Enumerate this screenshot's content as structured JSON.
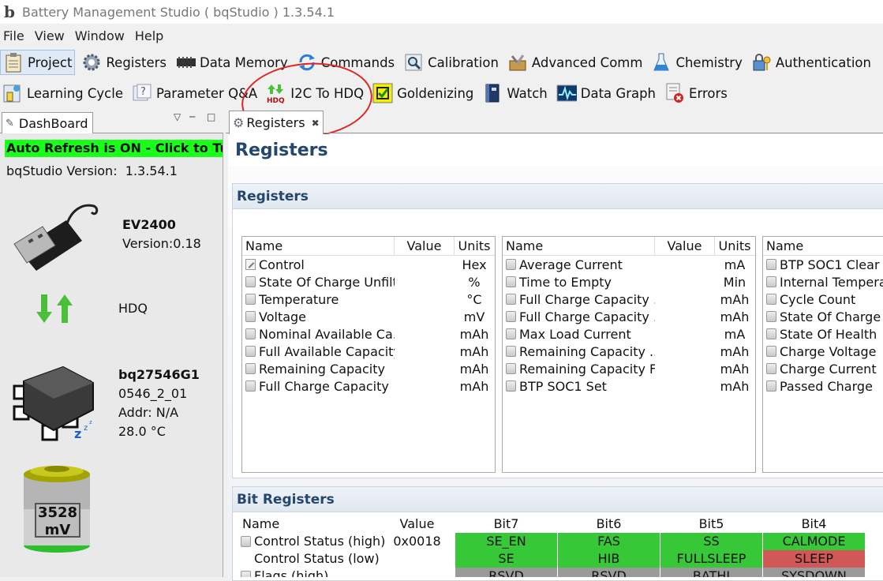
{
  "window": {
    "title": "Battery Management Studio ( bqStudio ) 1.3.54.1"
  },
  "menu": [
    "File",
    "View",
    "Window",
    "Help"
  ],
  "toolbar1": [
    {
      "label": "Project",
      "icon": "clipboard-icon"
    },
    {
      "label": "Registers",
      "icon": "gear-icon"
    },
    {
      "label": "Data Memory",
      "icon": "chip-icon"
    },
    {
      "label": "Commands",
      "icon": "refresh-arrows-icon"
    },
    {
      "label": "Calibration",
      "icon": "magnifier-icon"
    },
    {
      "label": "Advanced Comm",
      "icon": "tools-icon"
    },
    {
      "label": "Chemistry",
      "icon": "flask-icon"
    },
    {
      "label": "Authentication",
      "icon": "lock-key-icon"
    }
  ],
  "toolbar2": [
    {
      "label": "Learning Cycle",
      "icon": "learning-cycle-icon"
    },
    {
      "label": "Parameter Q&A",
      "icon": "question-icon"
    },
    {
      "label": "I2C To HDQ",
      "icon": "i2c-hdq-icon"
    },
    {
      "label": "Goldenizing",
      "icon": "checkbox-icon"
    },
    {
      "label": "Watch",
      "icon": "book-icon"
    },
    {
      "label": "Data Graph",
      "icon": "graph-icon"
    },
    {
      "label": "Errors",
      "icon": "errors-icon"
    }
  ],
  "dashboard": {
    "tab_label": "DashBoard",
    "auto_refresh": "Auto Refresh is ON - Click to Turn OFF",
    "version_label": "bqStudio Version:",
    "version_value": "1.3.54.1",
    "adapter_name": "EV2400",
    "adapter_version": "Version:0.18",
    "protocol": "HDQ",
    "device_name": "bq27546G1",
    "device_fw": "0546_2_01",
    "device_addr": "Addr: N/A",
    "device_temp": "28.0 °C",
    "battery_voltage": "3528",
    "battery_unit": "mV"
  },
  "editor": {
    "tab_label": "Registers",
    "page_title": "Registers",
    "section_registers": "Registers",
    "section_bits": "Bit Registers"
  },
  "col_headers": {
    "name": "Name",
    "value": "Value",
    "units": "Units"
  },
  "table1": [
    {
      "name": "Control",
      "units": "Hex",
      "editable": true
    },
    {
      "name": "State Of Charge Unfilt...",
      "units": "%"
    },
    {
      "name": "Temperature",
      "units": "°C"
    },
    {
      "name": "Voltage",
      "units": "mV"
    },
    {
      "name": "Nominal Available Ca...",
      "units": "mAh"
    },
    {
      "name": "Full Available Capacity",
      "units": "mAh"
    },
    {
      "name": "Remaining Capacity",
      "units": "mAh"
    },
    {
      "name": "Full Charge Capacity",
      "units": "mAh"
    }
  ],
  "table2": [
    {
      "name": "Average Current",
      "units": "mA"
    },
    {
      "name": "Time to Empty",
      "units": "Min"
    },
    {
      "name": "Full Charge Capacity ...",
      "units": "mAh"
    },
    {
      "name": "Full Charge Capacity ...",
      "units": "mAh"
    },
    {
      "name": "Max Load Current",
      "units": "mA"
    },
    {
      "name": "Remaining Capacity ...",
      "units": "mAh"
    },
    {
      "name": "Remaining Capacity F...",
      "units": "mAh"
    },
    {
      "name": "BTP SOC1 Set",
      "units": "mAh"
    }
  ],
  "table3": [
    {
      "name": "BTP SOC1 Clear"
    },
    {
      "name": "Internal Temperature"
    },
    {
      "name": "Cycle Count"
    },
    {
      "name": "State Of Charge"
    },
    {
      "name": "State Of Health"
    },
    {
      "name": "Charge Voltage"
    },
    {
      "name": "Charge Current"
    },
    {
      "name": "Passed Charge"
    }
  ],
  "bit_table": {
    "headers": [
      "Name",
      "Value",
      "Bit7",
      "Bit6",
      "Bit5",
      "Bit4"
    ],
    "rows": [
      {
        "name": "Control Status (high)",
        "value": "0x0018",
        "bits": [
          "SE_EN",
          "FAS",
          "SS",
          "CALMODE"
        ],
        "colors": [
          "green",
          "green",
          "green",
          "green"
        ],
        "locked": true
      },
      {
        "name": "Control Status (low)",
        "value": "",
        "bits": [
          "SE",
          "HIB",
          "FULLSLEEP",
          "SLEEP"
        ],
        "colors": [
          "green",
          "green",
          "green",
          "red"
        ],
        "locked": false
      },
      {
        "name": "Flags (high)",
        "value": "",
        "bits": [
          "RSVD",
          "RSVD",
          "BATHI",
          "SYSDOWN"
        ],
        "colors": [
          "gray",
          "gray",
          "gray",
          "gray"
        ],
        "locked": true
      }
    ]
  },
  "colors": {
    "accent_title": "#25466d",
    "auto_refresh_bg": "#19ff19",
    "bit_on": "#37c837",
    "bit_alert": "#d25858",
    "annotation": "#e02424"
  }
}
